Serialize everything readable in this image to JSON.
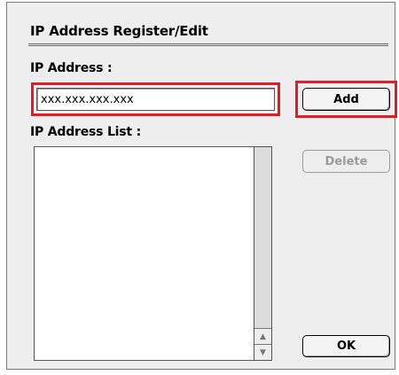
{
  "dialog": {
    "title": "IP Address Register/Edit"
  },
  "ip_field": {
    "label": "IP Address :",
    "value": "xxx.xxx.xxx.xxx"
  },
  "buttons": {
    "add": "Add",
    "delete": "Delete",
    "ok": "OK"
  },
  "ip_list": {
    "label": "IP Address List :",
    "items": []
  },
  "icons": {
    "scroll_up": "scroll-up-arrow-icon",
    "scroll_down": "scroll-down-arrow-icon"
  },
  "colors": {
    "highlight": "#e21b24",
    "dialog_bg": "#eeeeee"
  }
}
